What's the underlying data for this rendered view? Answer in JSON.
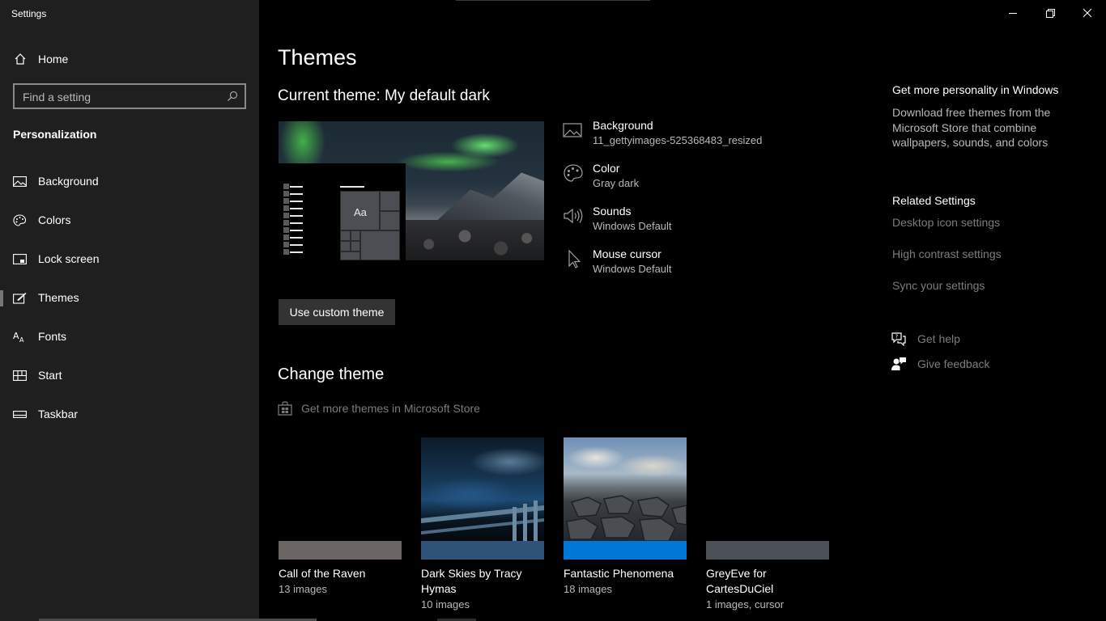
{
  "window": {
    "title": "Settings"
  },
  "sidebar": {
    "home_label": "Home",
    "search_placeholder": "Find a setting",
    "section_title": "Personalization",
    "items": [
      {
        "label": "Background",
        "icon": "image-icon"
      },
      {
        "label": "Colors",
        "icon": "palette-icon"
      },
      {
        "label": "Lock screen",
        "icon": "lock-screen-icon"
      },
      {
        "label": "Themes",
        "icon": "themes-icon",
        "selected": true
      },
      {
        "label": "Fonts",
        "icon": "fonts-icon"
      },
      {
        "label": "Start",
        "icon": "start-icon"
      },
      {
        "label": "Taskbar",
        "icon": "taskbar-icon"
      }
    ]
  },
  "main": {
    "title": "Themes",
    "current_theme": "Current theme: My default dark",
    "preview_tile_label": "Aa",
    "properties": [
      {
        "name": "Background",
        "value": "11_gettyimages-525368483_resized",
        "icon": "image-icon"
      },
      {
        "name": "Color",
        "value": "Gray dark",
        "icon": "palette-icon"
      },
      {
        "name": "Sounds",
        "value": "Windows Default",
        "icon": "speaker-icon"
      },
      {
        "name": "Mouse cursor",
        "value": "Windows Default",
        "icon": "cursor-icon"
      }
    ],
    "use_custom_button": "Use custom theme",
    "change_theme_title": "Change theme",
    "store_link": "Get more themes in Microsoft Store",
    "themes": [
      {
        "name": "Call of the Raven",
        "count": "13 images",
        "accent": "#6b6563"
      },
      {
        "name": "Dark Skies by Tracy Hymas",
        "count": "10 images",
        "accent": "#2f5377"
      },
      {
        "name": "Fantastic Phenomena",
        "count": "18 images",
        "accent": "#0078d7"
      },
      {
        "name": "GreyEve for CartesDuCiel",
        "count": "1 images, cursor",
        "accent": "#4b5157"
      }
    ]
  },
  "right": {
    "personality_title": "Get more personality in Windows",
    "personality_text": "Download free themes from the Microsoft Store that combine wallpapers, sounds, and colors",
    "related_title": "Related Settings",
    "related_links": [
      "Desktop icon settings",
      "High contrast settings",
      "Sync your settings"
    ],
    "get_help": "Get help",
    "give_feedback": "Give feedback"
  }
}
